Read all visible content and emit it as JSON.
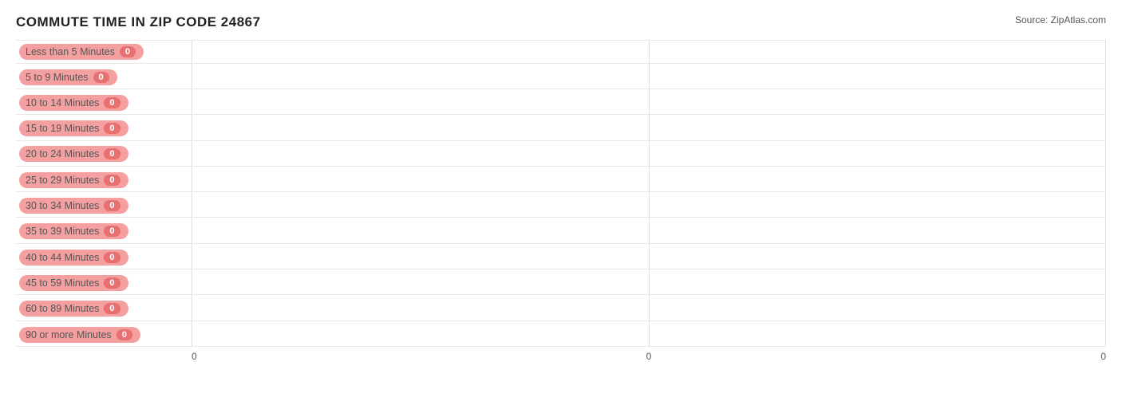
{
  "chart": {
    "title": "COMMUTE TIME IN ZIP CODE 24867",
    "source": "Source: ZipAtlas.com",
    "x_axis_labels": [
      "0",
      "0",
      "0"
    ],
    "bars": [
      {
        "label": "Less than 5 Minutes",
        "value": 0
      },
      {
        "label": "5 to 9 Minutes",
        "value": 0
      },
      {
        "label": "10 to 14 Minutes",
        "value": 0
      },
      {
        "label": "15 to 19 Minutes",
        "value": 0
      },
      {
        "label": "20 to 24 Minutes",
        "value": 0
      },
      {
        "label": "25 to 29 Minutes",
        "value": 0
      },
      {
        "label": "30 to 34 Minutes",
        "value": 0
      },
      {
        "label": "35 to 39 Minutes",
        "value": 0
      },
      {
        "label": "40 to 44 Minutes",
        "value": 0
      },
      {
        "label": "45 to 59 Minutes",
        "value": 0
      },
      {
        "label": "60 to 89 Minutes",
        "value": 0
      },
      {
        "label": "90 or more Minutes",
        "value": 0
      }
    ]
  }
}
